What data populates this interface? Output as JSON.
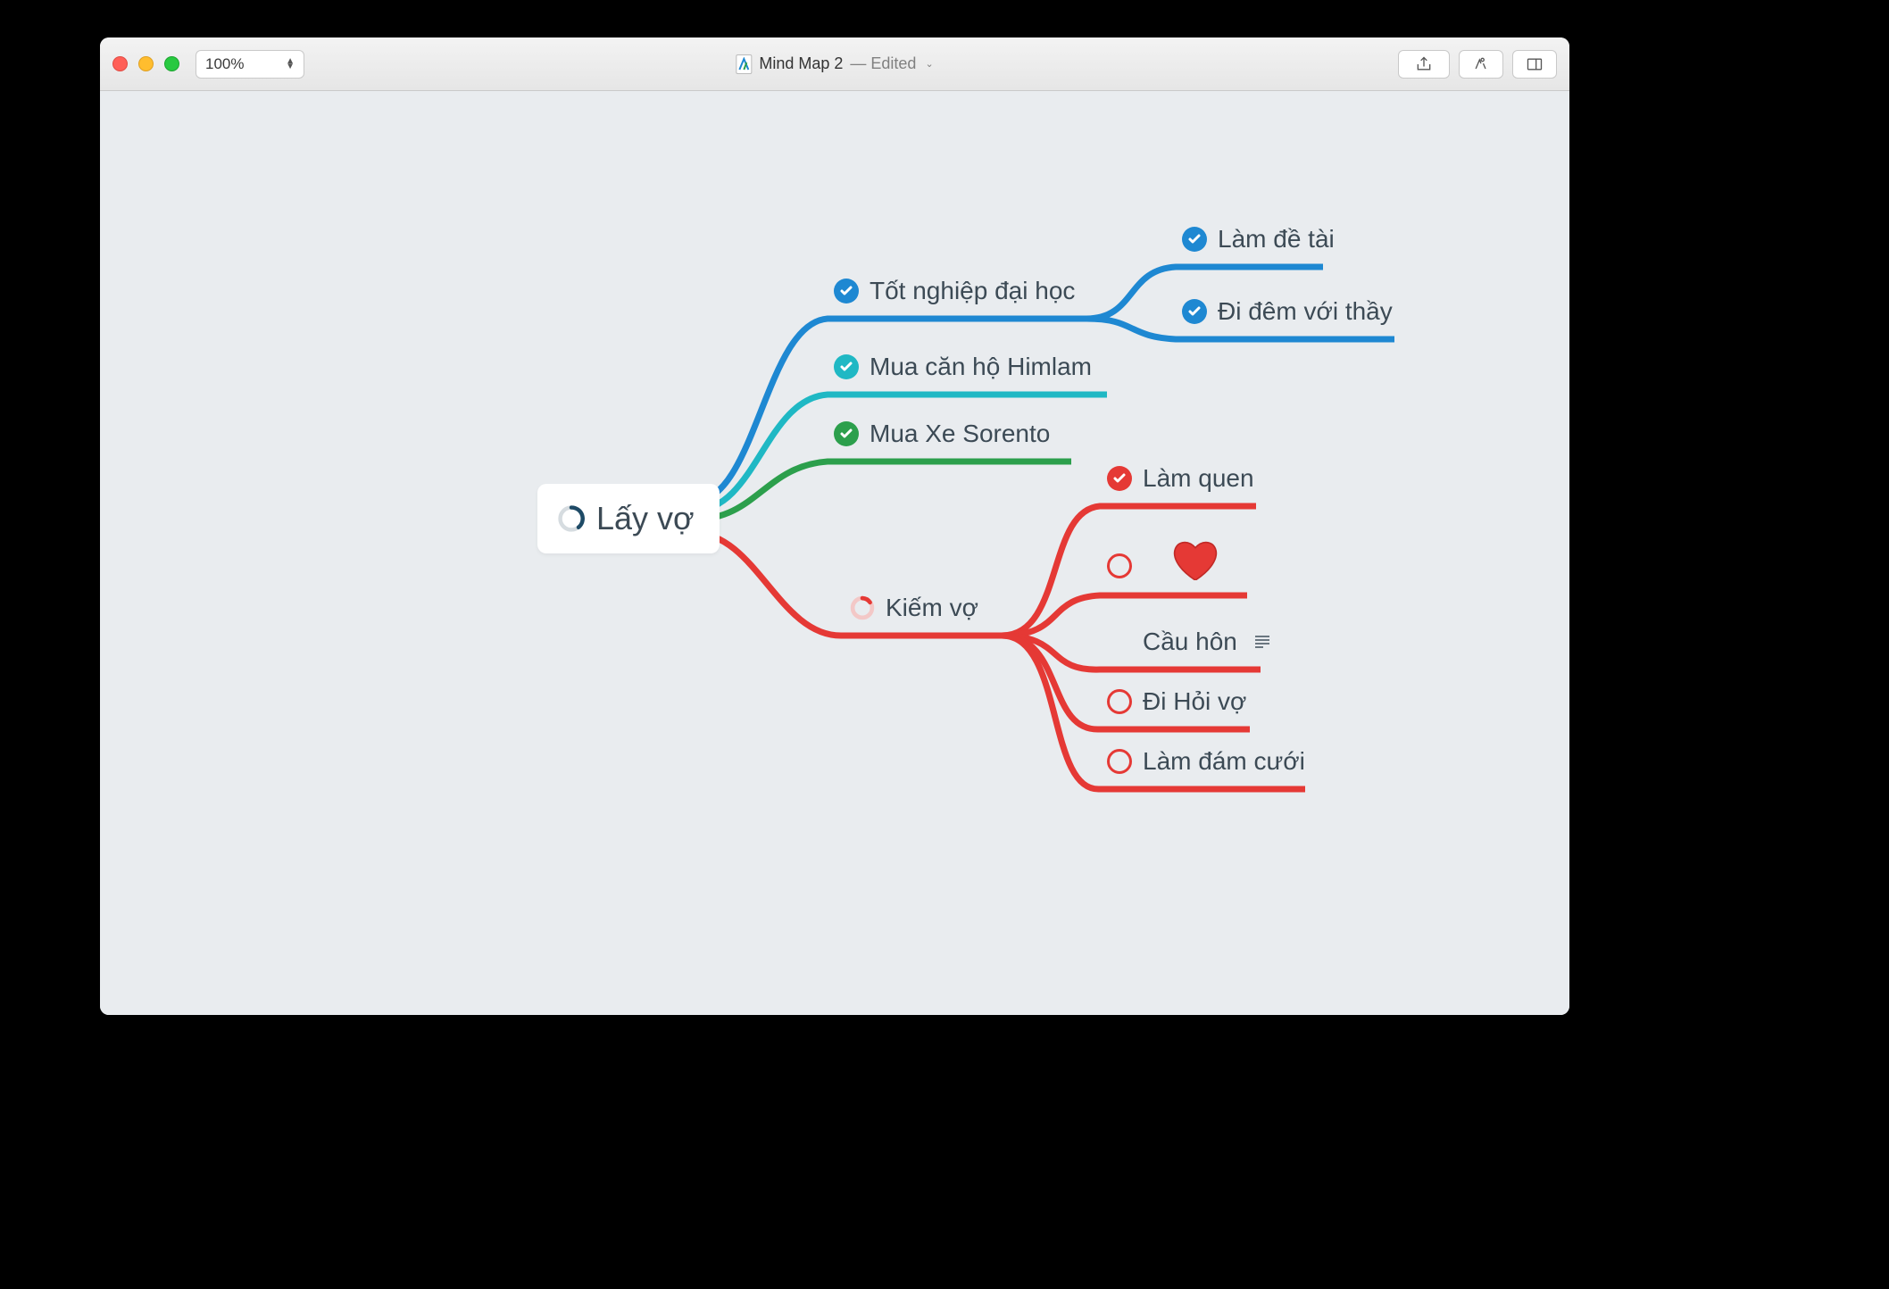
{
  "window": {
    "zoom_level": "100%",
    "title": "Mind Map 2",
    "status": "Edited"
  },
  "colors": {
    "blue": "#1e88d2",
    "teal": "#1fb8c4",
    "green": "#2c9f4c",
    "red": "#e53935",
    "text": "#3c4a55"
  },
  "mindmap": {
    "root": {
      "label": "Lấy vợ",
      "progress": "partial"
    },
    "branches": [
      {
        "id": "grad",
        "label": "Tốt nghiệp đại học",
        "color": "blue",
        "status": "checked",
        "children": [
          {
            "id": "thesis",
            "label": "Làm đề tài",
            "color": "blue",
            "status": "checked"
          },
          {
            "id": "night",
            "label": "Đi đêm với thầy",
            "color": "blue",
            "status": "checked"
          }
        ]
      },
      {
        "id": "apt",
        "label": "Mua căn hộ Himlam",
        "color": "teal",
        "status": "checked"
      },
      {
        "id": "car",
        "label": "Mua Xe Sorento",
        "color": "green",
        "status": "checked"
      },
      {
        "id": "wife",
        "label": "Kiếm vợ",
        "color": "red",
        "status": "progress",
        "children": [
          {
            "id": "meet",
            "label": "Làm quen",
            "color": "red",
            "status": "checked"
          },
          {
            "id": "love",
            "label": "",
            "color": "red",
            "status": "empty",
            "icon": "heart"
          },
          {
            "id": "propose",
            "label": "Cầu hôn",
            "color": "red",
            "status": "empty-gray",
            "has_note": true
          },
          {
            "id": "ask",
            "label": "Đi Hỏi vợ",
            "color": "red",
            "status": "empty"
          },
          {
            "id": "wedding",
            "label": "Làm đám cưới",
            "color": "red",
            "status": "empty"
          }
        ]
      }
    ]
  }
}
